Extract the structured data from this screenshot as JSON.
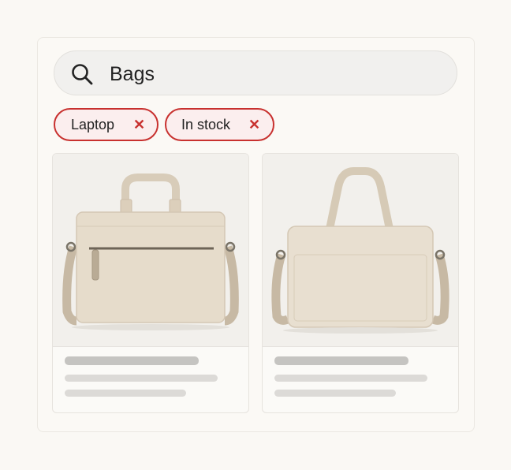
{
  "search": {
    "value": "Bags",
    "icon": "search-icon"
  },
  "filters": [
    {
      "label": "Laptop",
      "close_icon": "close-icon",
      "close_glyph": "✕"
    },
    {
      "label": "In stock",
      "close_icon": "close-icon",
      "close_glyph": "✕"
    }
  ],
  "products": [
    {
      "image": "laptop-bag-with-front-zipper"
    },
    {
      "image": "laptop-bag-with-tall-handles"
    }
  ],
  "colors": {
    "accent": "#c8312f",
    "chip_background": "#fbeeee",
    "bag": "#e6dccb",
    "strap": "#cbbda8"
  }
}
